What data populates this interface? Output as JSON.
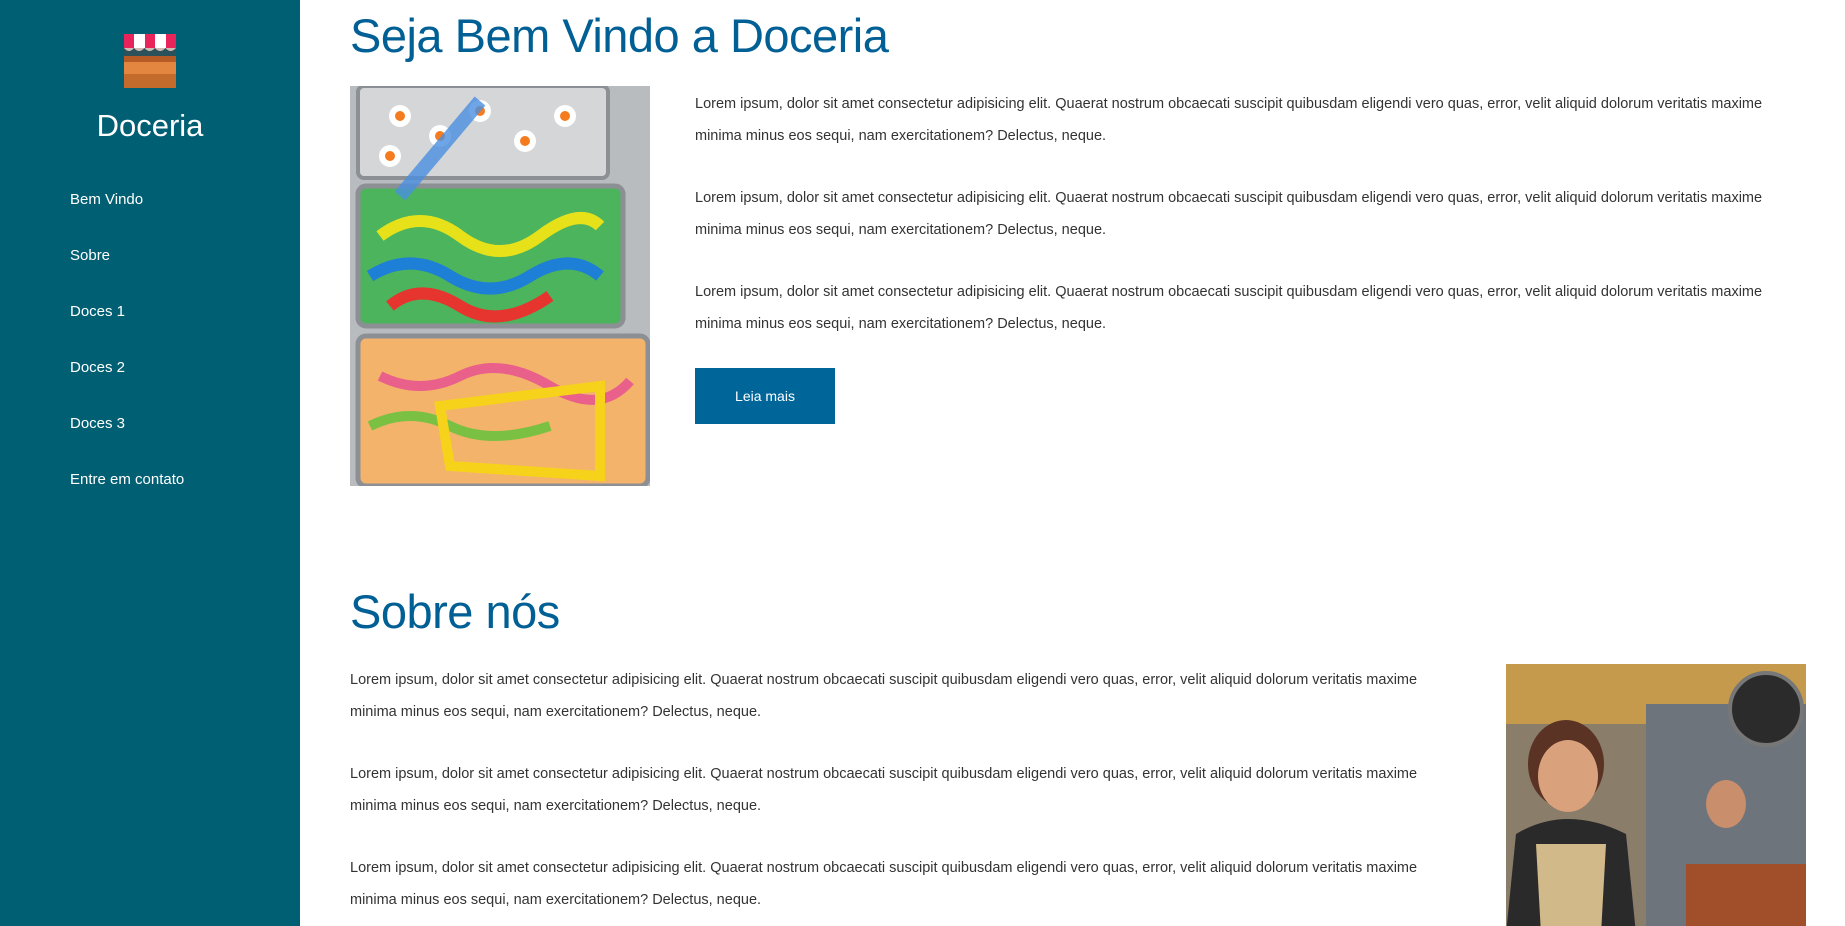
{
  "sidebar": {
    "brand": "Doceria",
    "logo_icon": "candy-shop-stall-icon",
    "nav": [
      {
        "label": "Bem Vindo"
      },
      {
        "label": "Sobre"
      },
      {
        "label": "Doces 1"
      },
      {
        "label": "Doces 2"
      },
      {
        "label": "Doces 3"
      },
      {
        "label": "Entre em contato"
      }
    ]
  },
  "welcome": {
    "title": "Seja Bem Vindo a Doceria",
    "paragraphs": [
      "Lorem ipsum, dolor sit amet consectetur adipisicing elit. Quaerat nostrum obcaecati suscipit quibusdam eligendi vero quas, error, velit aliquid dolorum veritatis maxime minima minus eos sequi, nam exercitationem? Delectus, neque.",
      "Lorem ipsum, dolor sit amet consectetur adipisicing elit. Quaerat nostrum obcaecati suscipit quibusdam eligendi vero quas, error, velit aliquid dolorum veritatis maxime minima minus eos sequi, nam exercitationem? Delectus, neque.",
      "Lorem ipsum, dolor sit amet consectetur adipisicing elit. Quaerat nostrum obcaecati suscipit quibusdam eligendi vero quas, error, velit aliquid dolorum veritatis maxime minima minus eos sequi, nam exercitationem? Delectus, neque."
    ],
    "button_label": "Leia mais"
  },
  "about": {
    "title": "Sobre nós",
    "paragraphs": [
      "Lorem ipsum, dolor sit amet consectetur adipisicing elit. Quaerat nostrum obcaecati suscipit quibusdam eligendi vero quas, error, velit aliquid dolorum veritatis maxime minima minus eos sequi, nam exercitationem? Delectus, neque.",
      "Lorem ipsum, dolor sit amet consectetur adipisicing elit. Quaerat nostrum obcaecati suscipit quibusdam eligendi vero quas, error, velit aliquid dolorum veritatis maxime minima minus eos sequi, nam exercitationem? Delectus, neque.",
      "Lorem ipsum, dolor sit amet consectetur adipisicing elit. Quaerat nostrum obcaecati suscipit quibusdam eligendi vero quas, error, velit aliquid dolorum veritatis maxime minima minus eos sequi, nam exercitationem? Delectus, neque."
    ]
  },
  "colors": {
    "sidebar": "#005f73",
    "heading": "#005f95",
    "button": "#00669a"
  }
}
